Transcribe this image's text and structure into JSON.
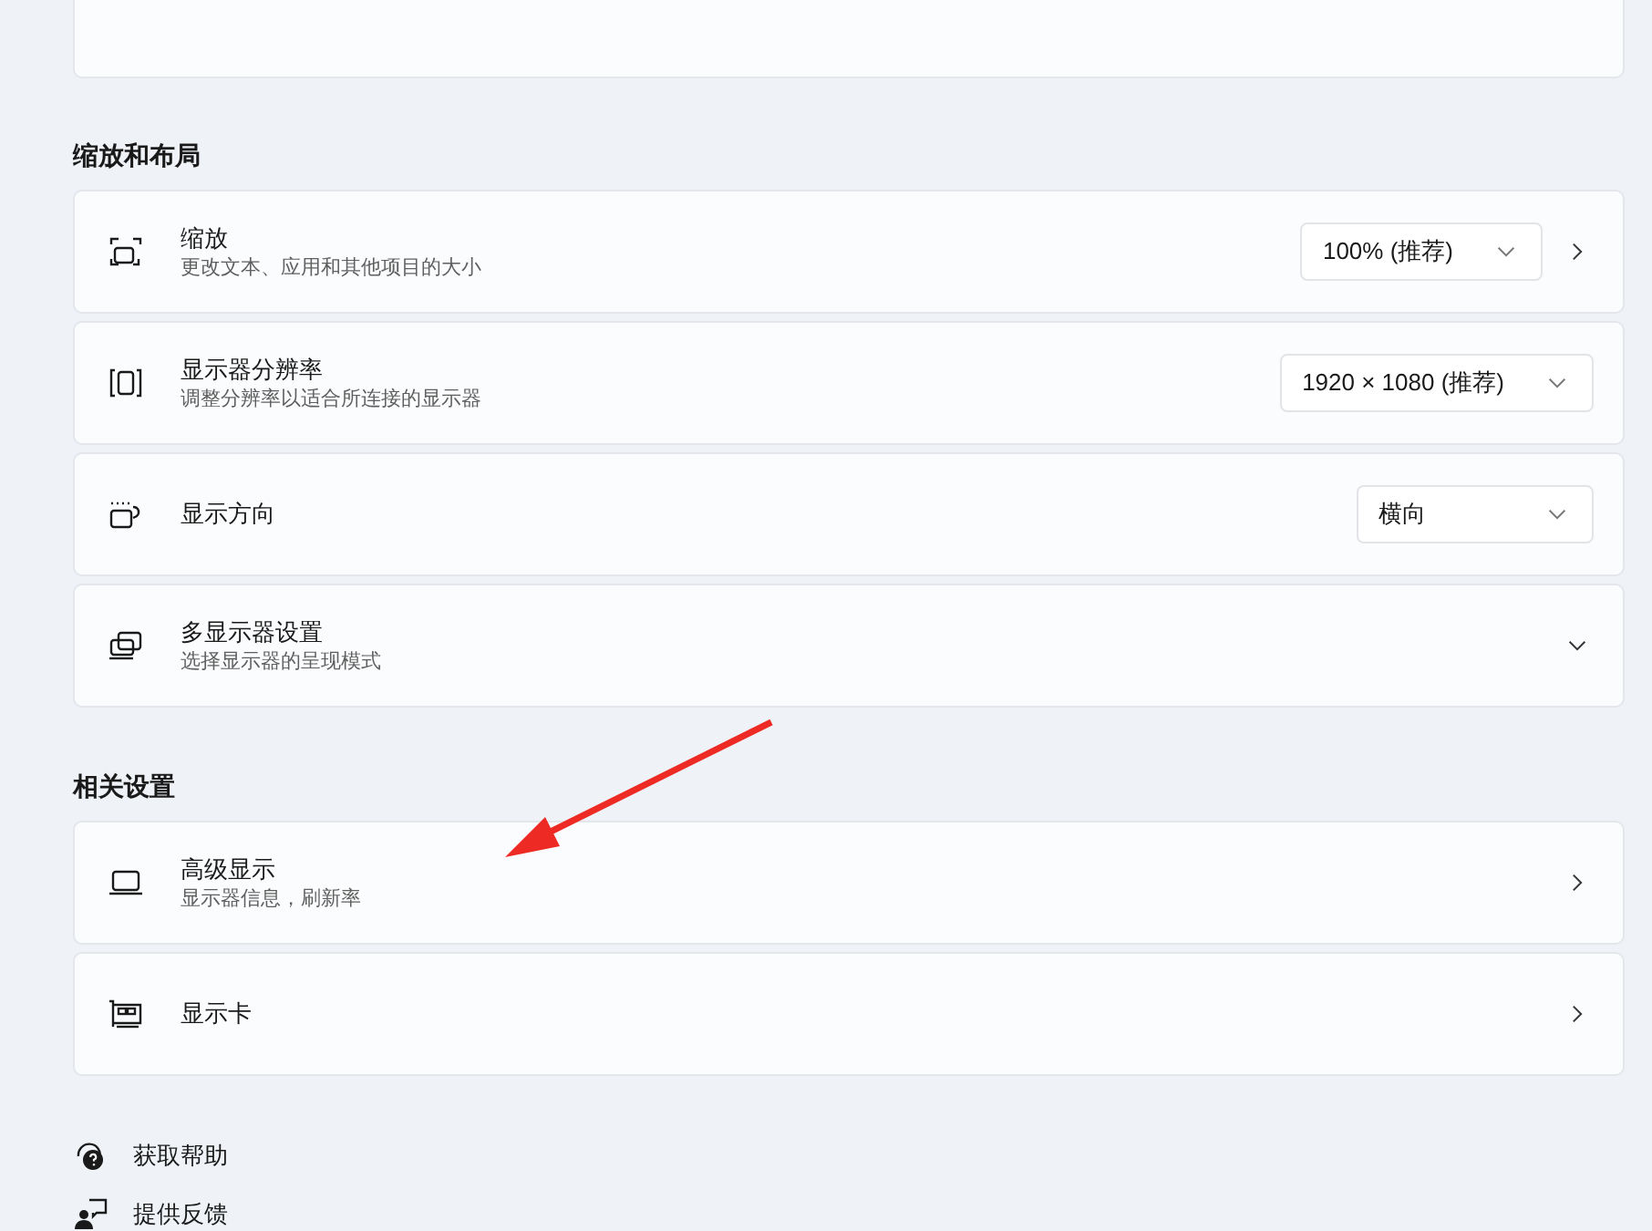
{
  "sections": [
    {
      "heading": "缩放和布局",
      "rows": [
        {
          "kind": "dropdown_link",
          "title": "缩放",
          "subtitle": "更改文本、应用和其他项目的大小",
          "dropdown": "100% (推荐)"
        },
        {
          "kind": "dropdown",
          "title": "显示器分辨率",
          "subtitle": "调整分辨率以适合所连接的显示器",
          "dropdown": "1920 × 1080 (推荐)"
        },
        {
          "kind": "dropdown",
          "title": "显示方向",
          "dropdown": "横向"
        },
        {
          "kind": "expander",
          "title": "多显示器设置",
          "subtitle": "选择显示器的呈现模式",
          "expanded": false
        }
      ]
    },
    {
      "heading": "相关设置",
      "rows": [
        {
          "kind": "link",
          "title": "高级显示",
          "subtitle": "显示器信息，刷新率"
        },
        {
          "kind": "link",
          "title": "显示卡"
        }
      ]
    }
  ],
  "links": [
    {
      "label": "获取帮助"
    },
    {
      "label": "提供反馈"
    }
  ]
}
